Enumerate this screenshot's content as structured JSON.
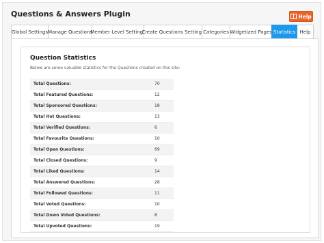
{
  "page": {
    "title": "Questions & Answers Plugin"
  },
  "help_button": {
    "label": "Help",
    "icon": "help-book-icon",
    "color": "#e8662c"
  },
  "tabs": [
    {
      "label": "Global Settings",
      "active": false
    },
    {
      "label": "Manage Questions",
      "active": false
    },
    {
      "label": "Member Level Settings",
      "active": false
    },
    {
      "label": "Create Questions Settings",
      "active": false
    },
    {
      "label": "Categories",
      "active": false
    },
    {
      "label": "Widgetized Pages",
      "active": false
    },
    {
      "label": "Statistics",
      "active": true
    },
    {
      "label": "Help",
      "active": false
    }
  ],
  "accent_color": "#1e98e8",
  "statistics": {
    "heading": "Question Statistics",
    "description": "Below are some valuable statistics for the Questions created on this site:",
    "rows": [
      {
        "label": "Total Questions:",
        "value": "70"
      },
      {
        "label": "Total Featured Questions:",
        "value": "12"
      },
      {
        "label": "Total Sponsored Questions:",
        "value": "18"
      },
      {
        "label": "Total Hot Questions:",
        "value": "13"
      },
      {
        "label": "Total Verified Questions:",
        "value": "6"
      },
      {
        "label": "Total Favourite Questions:",
        "value": "10"
      },
      {
        "label": "Total Open Questions:",
        "value": "69"
      },
      {
        "label": "Total Closed Questions:",
        "value": "9"
      },
      {
        "label": "Total Liked Questions:",
        "value": "14"
      },
      {
        "label": "Total Answered Questions:",
        "value": "28"
      },
      {
        "label": "Total Followed Questions:",
        "value": "11"
      },
      {
        "label": "Total Voted Questions:",
        "value": "10"
      },
      {
        "label": "Total Down Voted Questions:",
        "value": "8"
      },
      {
        "label": "Total Upvoted Questions:",
        "value": "19"
      }
    ]
  }
}
